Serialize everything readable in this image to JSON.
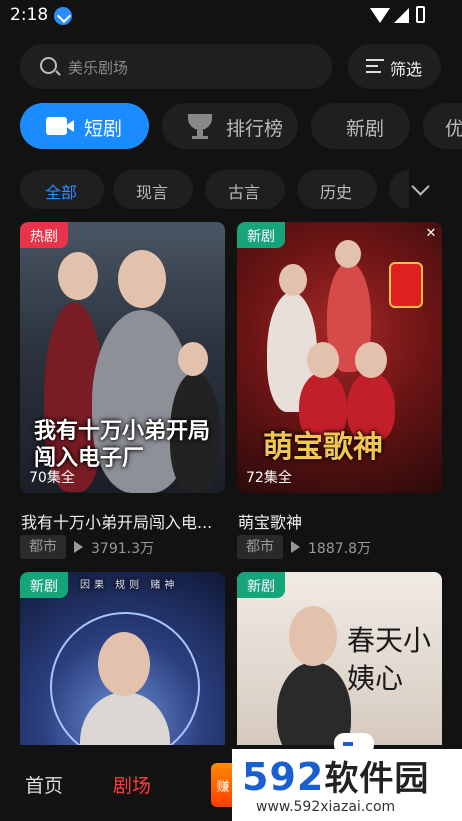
{
  "status_bar": {
    "time": "2:18"
  },
  "search": {
    "placeholder": "美乐剧场",
    "filter_label": "筛选"
  },
  "tabs": [
    {
      "label": "短剧",
      "active": true
    },
    {
      "label": "排行榜"
    },
    {
      "label": "新剧"
    },
    {
      "label": "优"
    }
  ],
  "categories": [
    {
      "label": "全部",
      "active": true
    },
    {
      "label": "现言"
    },
    {
      "label": "古言"
    },
    {
      "label": "历史"
    }
  ],
  "cards": [
    {
      "badge": "热剧",
      "poster_title": "我有十万小弟开局闯入电子厂",
      "episodes": "70集全",
      "title": "我有十万小弟开局闯入电...",
      "genre": "都市",
      "views": "3791.3万"
    },
    {
      "badge": "新剧",
      "poster_title": "萌宝歌神",
      "episodes": "72集全",
      "title": "萌宝歌神",
      "genre": "都市",
      "views": "1887.8万"
    },
    {
      "badge": "新剧",
      "poster_title": "因果 规则 赌神"
    },
    {
      "badge": "新剧",
      "poster_title": "春天小姨心"
    }
  ],
  "bottom_nav": [
    {
      "label": "首页"
    },
    {
      "label": "剧场",
      "active": true
    }
  ],
  "earn_label": "赚",
  "watermark": {
    "brand": "592",
    "brand_cn": "软件园",
    "url": "www.592xiazai.com"
  },
  "colors": {
    "accent": "#1a8cff",
    "hot_badge": "#e8334a",
    "new_badge": "#16a57a",
    "nav_active": "#ff3b3b"
  }
}
